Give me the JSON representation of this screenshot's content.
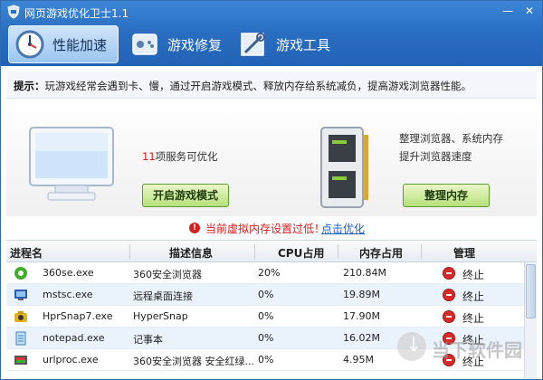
{
  "window": {
    "title": "网页游戏优化卫士1.1",
    "minimize": "—",
    "close": "✕"
  },
  "tabs": [
    {
      "label": "性能加速",
      "icon": "clock-gauge-icon",
      "active": true
    },
    {
      "label": "游戏修复",
      "icon": "gamepad-repair-icon",
      "active": false
    },
    {
      "label": "游戏工具",
      "icon": "tools-icon",
      "active": false
    }
  ],
  "tip": {
    "label": "提示：",
    "text": "玩游戏经常会遇到卡、慢，通过开启游戏模式、释放内存给系统减负，提高游戏浏览器性能。"
  },
  "services": {
    "count": "11",
    "suffix": "项服务可优化",
    "button": "开启游戏模式"
  },
  "memory": {
    "desc_line1": "整理浏览器、系统内存",
    "desc_line2": "提升浏览器速度",
    "button": "整理内存"
  },
  "warning": {
    "text": "当前虚拟内存设置过低！",
    "link": "点击优化"
  },
  "table": {
    "headers": [
      "进程名",
      "描述信息",
      "CPU占用",
      "内存占用",
      "管理"
    ],
    "stop_label": "终止",
    "rows": [
      {
        "name": "360se.exe",
        "desc": "360安全浏览器",
        "cpu": "20%",
        "mem": "210.84M",
        "icon": "360-browser-icon"
      },
      {
        "name": "mstsc.exe",
        "desc": "远程桌面连接",
        "cpu": "0%",
        "mem": "19.89M",
        "icon": "remote-desktop-icon"
      },
      {
        "name": "HprSnap7.exe",
        "desc": "HyperSnap",
        "cpu": "0%",
        "mem": "17.90M",
        "icon": "hypersnap-icon"
      },
      {
        "name": "notepad.exe",
        "desc": "记事本",
        "cpu": "0%",
        "mem": "16.02M",
        "icon": "notepad-icon"
      },
      {
        "name": "urlproc.exe",
        "desc": "360安全浏览器 安全红绿...",
        "cpu": "0%",
        "mem": "4.95M",
        "icon": "urlproc-icon"
      }
    ]
  },
  "watermark": {
    "text": "当下软件园"
  },
  "colors": {
    "header_blue": "#2a6fc2",
    "warning_red": "#d61f1f",
    "link_blue": "#1a5fc0",
    "button_green": "#b6e07a"
  }
}
